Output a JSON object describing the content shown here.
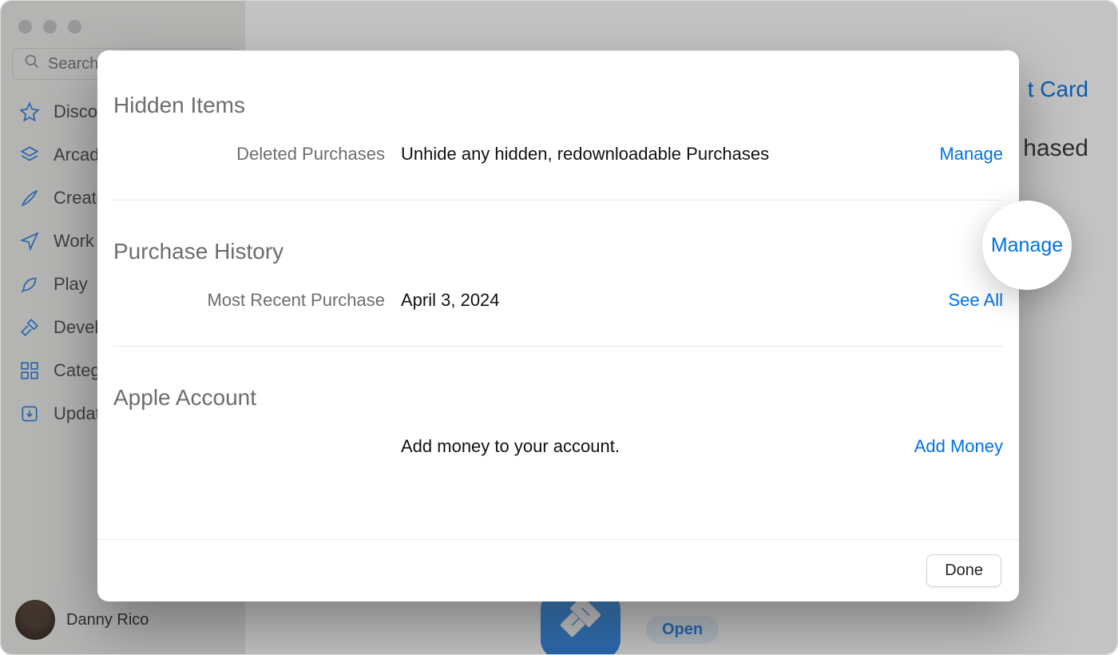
{
  "sidebar": {
    "search_placeholder": "Search",
    "items": [
      {
        "label": "Discover"
      },
      {
        "label": "Arcade"
      },
      {
        "label": "Create"
      },
      {
        "label": "Work"
      },
      {
        "label": "Play"
      },
      {
        "label": "Develop"
      },
      {
        "label": "Categories"
      },
      {
        "label": "Updates"
      }
    ],
    "profile_name": "Danny Rico"
  },
  "background": {
    "top_link_fragment": "t Card",
    "right_title_fragment": "hased",
    "open_label": "Open"
  },
  "sheet": {
    "sections": {
      "hidden": {
        "title": "Hidden Items",
        "row_key": "Deleted Purchases",
        "row_val": "Unhide any hidden, redownloadable Purchases",
        "action": "Manage"
      },
      "history": {
        "title": "Purchase History",
        "row_key": "Most Recent Purchase",
        "row_val": "April 3, 2024",
        "action": "See All"
      },
      "account": {
        "title": "Apple Account",
        "row_val": "Add money to your account.",
        "action": "Add Money"
      }
    },
    "done": "Done"
  },
  "highlight_label": "Manage"
}
